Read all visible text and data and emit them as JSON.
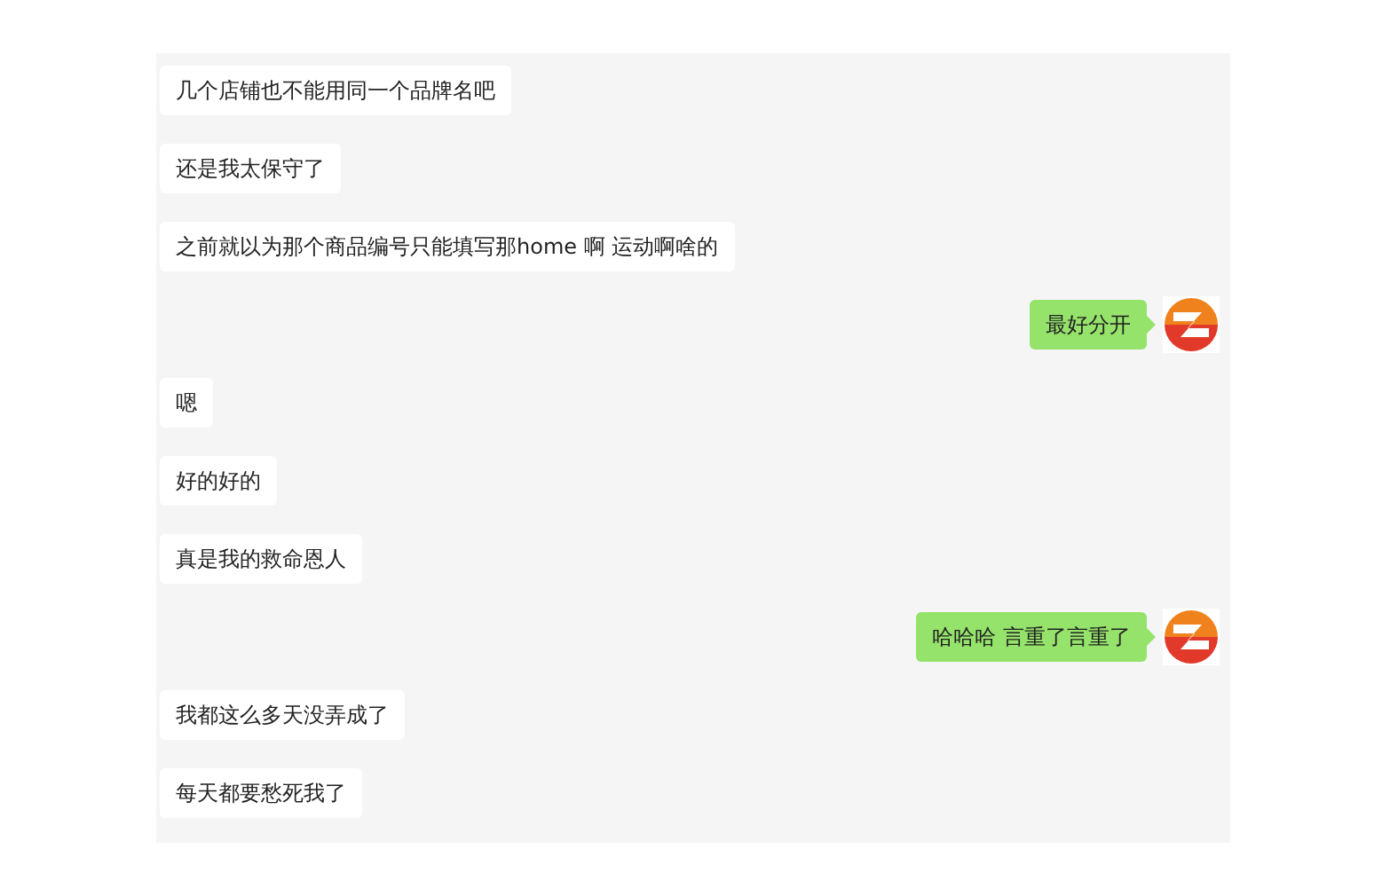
{
  "messages": [
    {
      "kind": "received",
      "text": "几个店铺也不能用同一个品牌名吧"
    },
    {
      "kind": "received",
      "text": "还是我太保守了"
    },
    {
      "kind": "received",
      "text": "之前就以为那个商品编号只能填写那home 啊 运动啊啥的"
    },
    {
      "kind": "sent",
      "text": "最好分开"
    },
    {
      "kind": "received",
      "text": "嗯"
    },
    {
      "kind": "received",
      "text": "好的好的"
    },
    {
      "kind": "received",
      "text": "真是我的救命恩人"
    },
    {
      "kind": "sent",
      "text": "哈哈哈 言重了言重了"
    },
    {
      "kind": "received",
      "text": "我都这么多天没弄成了"
    },
    {
      "kind": "received",
      "text": "每天都要愁死我了"
    }
  ]
}
